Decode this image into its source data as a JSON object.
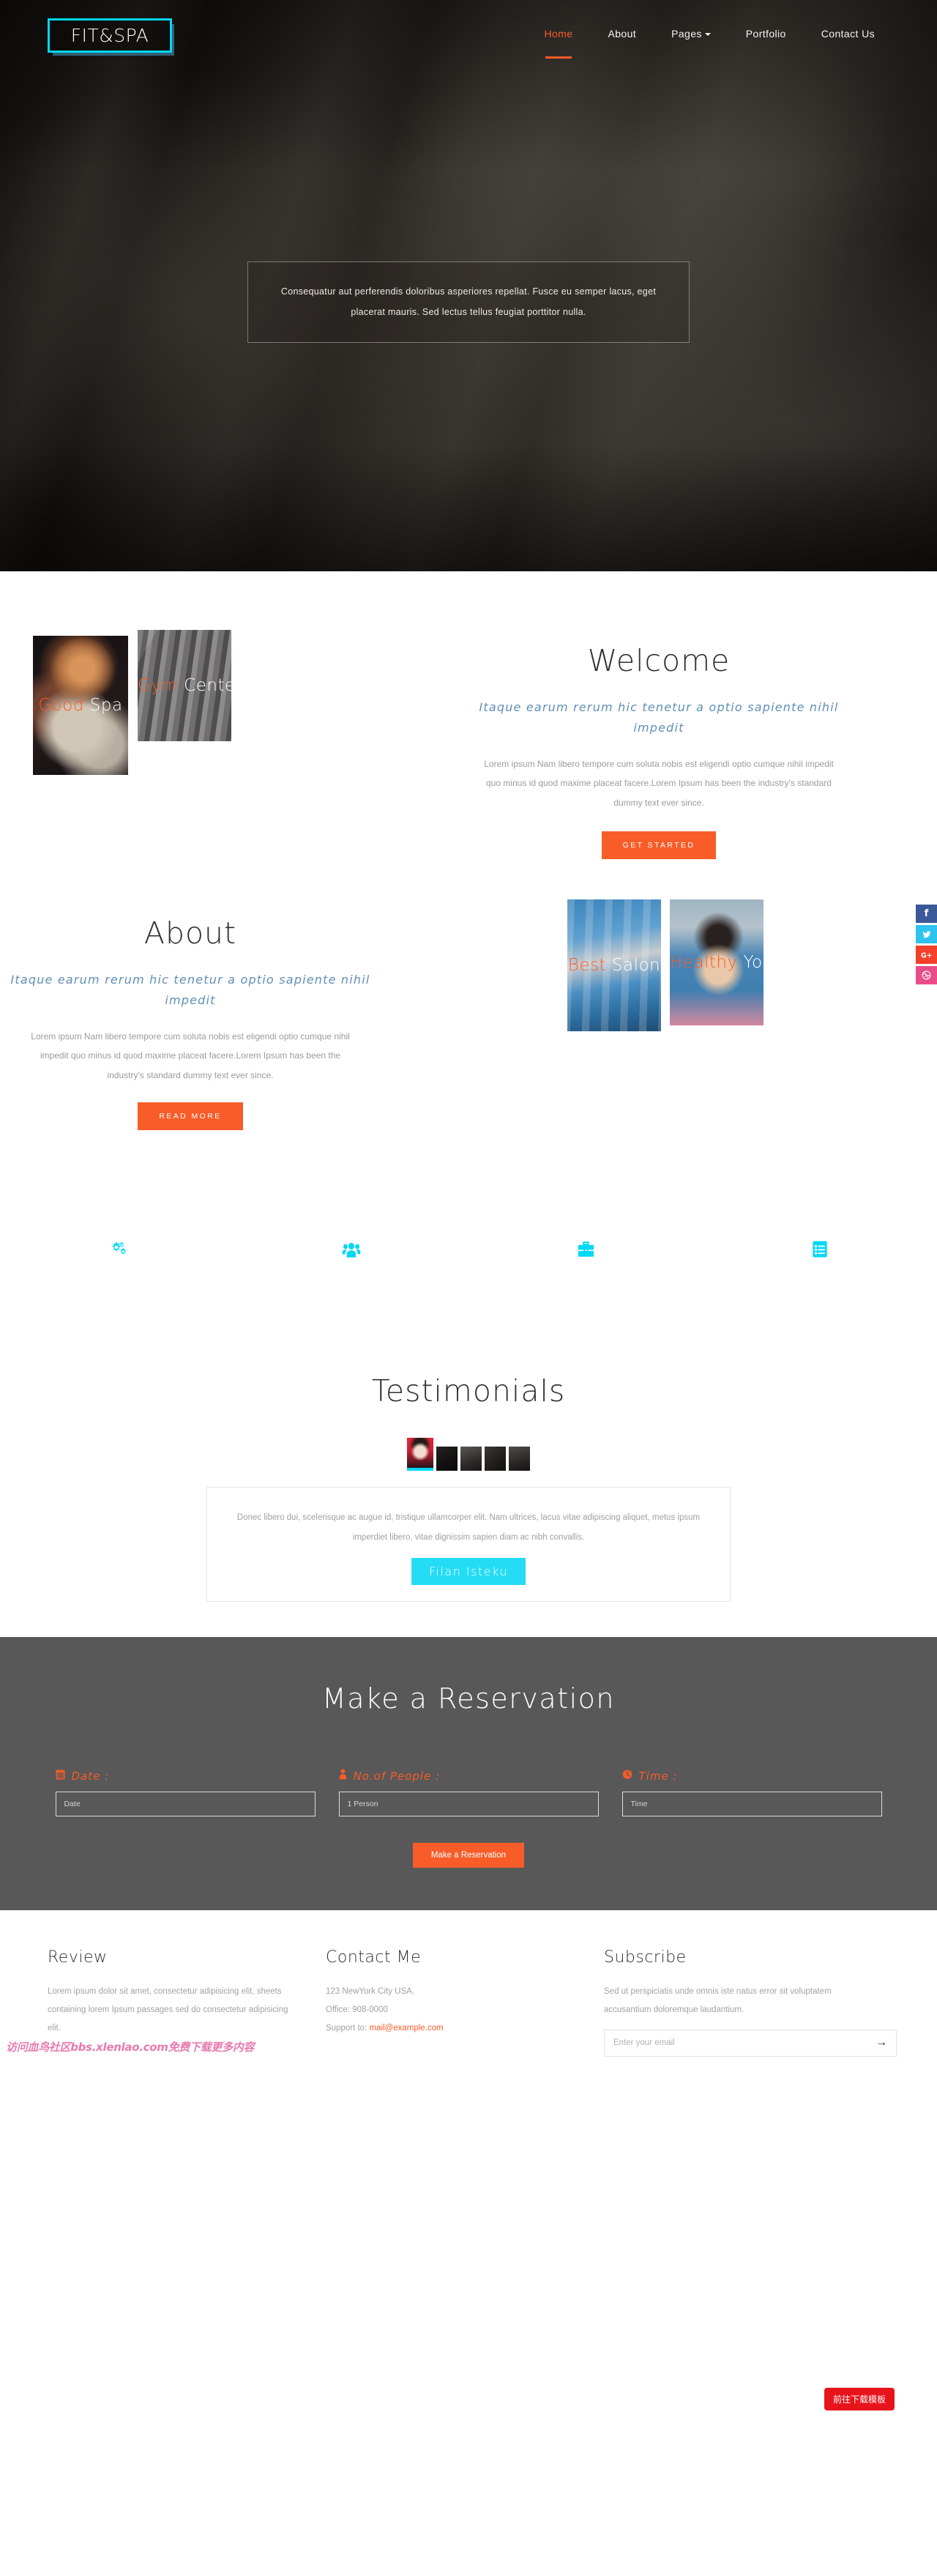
{
  "nav": {
    "logo": "FIT&SPA",
    "items": [
      {
        "label": "Home",
        "active": true,
        "caret": false
      },
      {
        "label": "About",
        "active": false,
        "caret": false
      },
      {
        "label": "Pages",
        "active": false,
        "caret": true
      },
      {
        "label": "Portfolio",
        "active": false,
        "caret": false
      },
      {
        "label": "Contact Us",
        "active": false,
        "caret": false
      }
    ]
  },
  "hero": {
    "title": "FIT&SPA",
    "description": "Consequatur aut perferendis doloribus asperiores repellat. Fusce eu semper lacus, eget placerat mauris. Sed lectus tellus feugiat porttitor nulla."
  },
  "welcome": {
    "title": "Welcome",
    "subtitle": "Itaque earum rerum hic tenetur a optio sapiente nihil impedit",
    "paragraph": "Lorem ipsum Nam libero tempore cum soluta nobis est eligendi optio cumque nihil impedit quo minus id quod maxime placeat facere.Lorem Ipsum has been the industry's standard dummy text ever since.",
    "cta": "GET STARTED",
    "cards": [
      {
        "highlight": "Good",
        "rest": " Spa"
      },
      {
        "highlight": "Gym",
        "rest": " Center"
      }
    ]
  },
  "about": {
    "title": "About",
    "subtitle": "Itaque earum rerum hic tenetur a optio sapiente nihil impedit",
    "paragraph": "Lorem ipsum Nam libero tempore cum soluta nobis est eligendi optio cumque nihil impedit quo minus id quod maxime placeat facere.Lorem Ipsum has been the industry's standard dummy text ever since.",
    "cta": "READ MORE",
    "cards": [
      {
        "highlight": "Best",
        "rest": " Salon"
      },
      {
        "highlight": "Healthy",
        "rest": " Yoga"
      }
    ]
  },
  "features": {
    "icons": [
      "cogs-icon",
      "users-icon",
      "briefcase-icon",
      "list-alt-icon"
    ],
    "color": "#00d8f5"
  },
  "testimonials": {
    "title": "Testimonials",
    "quote": "Donec libero dui, scelerisque ac augue id, tristique ullamcorper elit. Nam ultrices, lacus vitae adipiscing aliquet, metus ipsum imperdiet libero, vitae dignissim sapien diam ac nibh convallis.",
    "cta": "Filan Isteku",
    "thumb_count": 5,
    "active_index": 0
  },
  "reservation": {
    "title": "Make a Reservation",
    "fields": [
      {
        "icon": "calendar-icon",
        "label": "Date :",
        "placeholder": "Date",
        "value": ""
      },
      {
        "icon": "person-icon",
        "label": "No.of People :",
        "placeholder": "1 Person",
        "value": ""
      },
      {
        "icon": "clock-icon",
        "label": "Time :",
        "placeholder": "Time",
        "value": ""
      }
    ],
    "cta": "Make a Reservation"
  },
  "footer": {
    "review": {
      "title": "Review",
      "text": "Lorem ipsum dolor sit amet, consectetur adipisicing elit, sheets containing lorem Ipsum passages sed do consectetur adipisicing elit."
    },
    "contact": {
      "title": "Contact Me",
      "address": "123 NewYork City USA.",
      "office": "Office: 908-0000",
      "support_label": "Support to: ",
      "support_email": "mail@example.com"
    },
    "subscribe": {
      "title": "Subscribe",
      "text": "Sed ut perspiciatis unde omnis iste natus error sit voluptatem accusantium doloremque laudantium.",
      "placeholder": "Enter your email",
      "value": "",
      "arrow": "→"
    }
  },
  "social": [
    {
      "name": "facebook",
      "glyph": "f",
      "color": "#3b5998"
    },
    {
      "name": "twitter",
      "glyph": "🐦",
      "color": "#2fc2ef"
    },
    {
      "name": "google-plus",
      "glyph": "G+",
      "color": "#f4402b"
    },
    {
      "name": "dribbble",
      "glyph": "◎",
      "color": "#ea4c89"
    }
  ],
  "overlays": {
    "watermark": "访问血鸟社区bbs.xlenlao.com免费下载更多内容",
    "download_badge": "前往下载模板"
  }
}
